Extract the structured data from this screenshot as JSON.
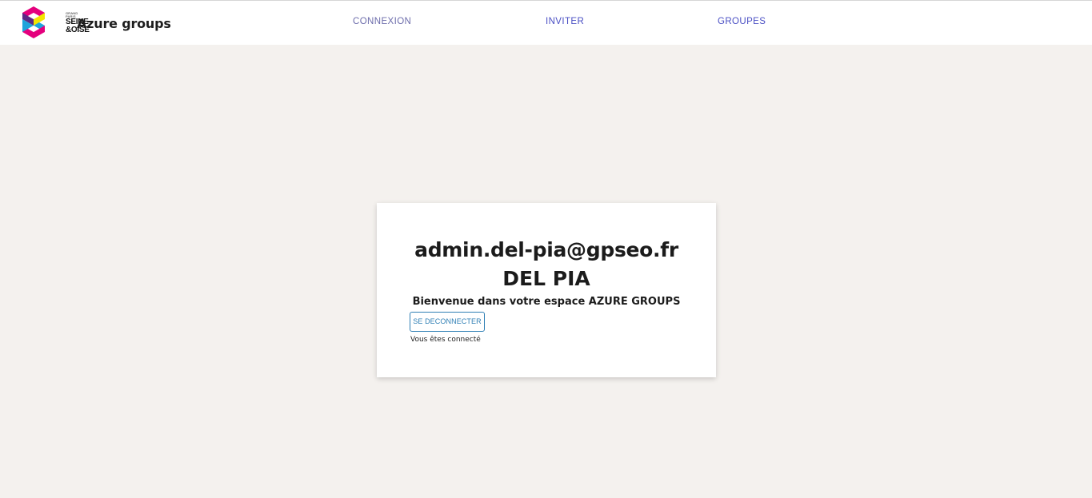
{
  "header": {
    "logo": {
      "icon": "seine-et-oise-s-logo",
      "small_text": "GRAND PARIS",
      "line1": "SEINE",
      "line2": "&OISE",
      "colors": [
        "#e4007d",
        "#1ea4db",
        "#f3e600",
        "#5b2a86"
      ]
    },
    "brand": "Azure groups",
    "nav": {
      "connexion": "CONNEXION",
      "inviter": "INVITER",
      "groupes": "GROUPES"
    }
  },
  "card": {
    "email": "admin.del-pia@gpseo.fr",
    "name": "DEL PIA",
    "welcome": "Bienvenue dans votre espace AZURE GROUPS",
    "logout_label": "SE DECONNECTER",
    "status": "Vous êtes connecté"
  },
  "colors": {
    "background": "#f4f1ee",
    "nav_link": "#4a4fc4",
    "button_accent": "#2f7fb5"
  }
}
